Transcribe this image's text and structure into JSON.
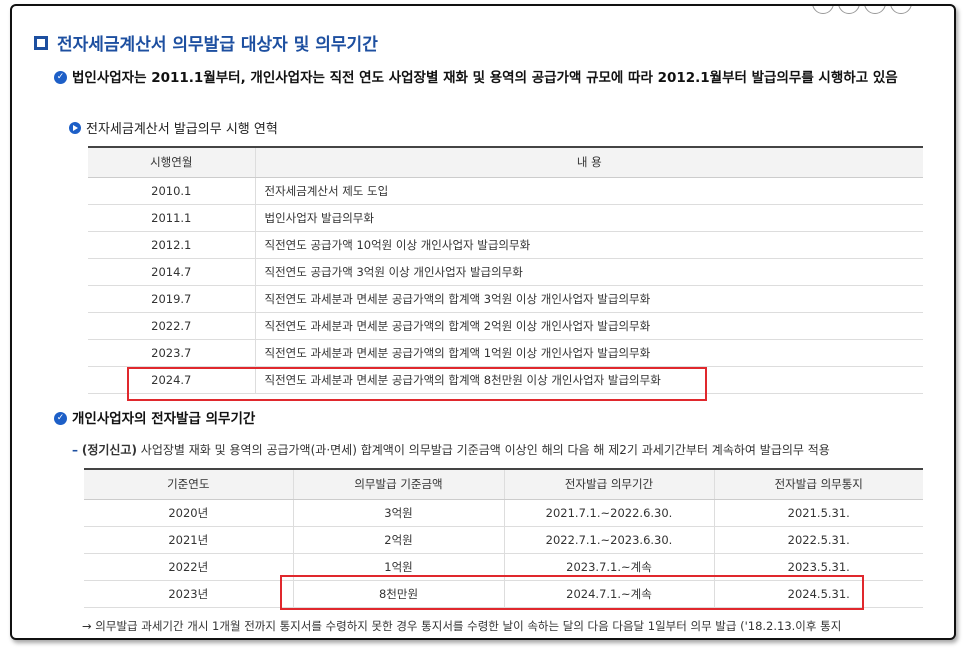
{
  "section": {
    "title": "전자세금계산서 의무발급 대상자 및 의무기간"
  },
  "intro": {
    "text": "법인사업자는 2011.1월부터, 개인사업자는 직전 연도 사업장별 재화 및 용역의 공급가액 규모에 따라 2012.1월부터 발급의무를 시행하고 있음"
  },
  "history": {
    "heading": "전자세금계산서 발급의무 시행 연혁",
    "columns": [
      "시행연월",
      "내 용"
    ],
    "rows": [
      [
        "2010.1",
        "전자세금계산서 제도 도입"
      ],
      [
        "2011.1",
        "법인사업자 발급의무화"
      ],
      [
        "2012.1",
        "직전연도 공급가액 10억원 이상 개인사업자 발급의무화"
      ],
      [
        "2014.7",
        "직전연도 공급가액 3억원 이상 개인사업자 발급의무화"
      ],
      [
        "2019.7",
        "직전연도 과세분과 면세분 공급가액의 합계액 3억원 이상 개인사업자 발급의무화"
      ],
      [
        "2022.7",
        "직전연도 과세분과 면세분 공급가액의 합계액 2억원 이상 개인사업자 발급의무화"
      ],
      [
        "2023.7",
        "직전연도 과세분과 면세분 공급가액의 합계액 1억원 이상 개인사업자 발급의무화"
      ],
      [
        "2024.7",
        "직전연도 과세분과 면세분 공급가액의 합계액 8천만원 이상 개인사업자 발급의무화"
      ]
    ]
  },
  "period": {
    "heading": "개인사업자의 전자발급 의무기간",
    "note_label": "(정기신고)",
    "note_text": " 사업장별 재화 및 용역의 공급가액(과·면세) 합계액이 의무발급 기준금액 이상인 해의 다음 해 제2기 과세기간부터 계속하여 발급의무 적용",
    "columns": [
      "기준연도",
      "의무발급 기준금액",
      "전자발급 의무기간",
      "전자발급 의무통지"
    ],
    "rows": [
      [
        "2020년",
        "3억원",
        "2021.7.1.~2022.6.30.",
        "2021.5.31."
      ],
      [
        "2021년",
        "2억원",
        "2022.7.1.~2023.6.30.",
        "2022.5.31."
      ],
      [
        "2022년",
        "1억원",
        "2023.7.1.~계속",
        "2023.5.31."
      ],
      [
        "2023년",
        "8천만원",
        "2024.7.1.~계속",
        "2024.5.31."
      ]
    ],
    "footnote": "→ 의무발급 과세기간 개시 1개월 전까지 통지서를 수령하지 못한 경우 통지서를 수령한 날이 속하는 달의 다음 다음달 1일부터 의무 발급 ('18.2.13.이후 통지"
  },
  "colors": {
    "accent": "#1d4fa0",
    "highlight": "#e0282d"
  }
}
